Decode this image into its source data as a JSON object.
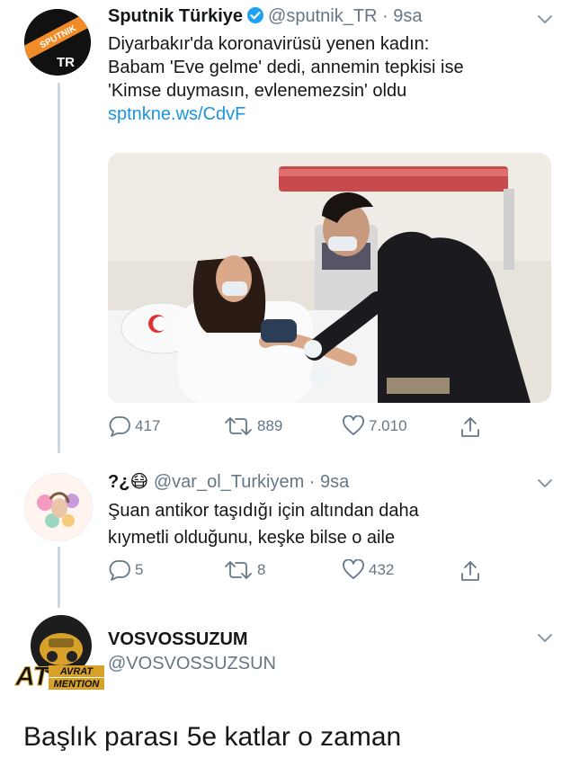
{
  "tweets": [
    {
      "name": "Sputnik Türkiye",
      "handle": "@sputnik_TR",
      "time": "9sa",
      "avatar_text": {
        "brand": "SPUTNIK",
        "country": "TR"
      },
      "text_lines": [
        "Diyarbakır'da koronavirüsü yenen kadın:",
        "Babam 'Eve gelme' dedi, annemin tepkisi ise",
        "'Kimse duymasın, evlenemezsin' oldu"
      ],
      "link": "sptnkne.ws/CdvF",
      "replies": "417",
      "retweets": "889",
      "likes": "7.010"
    },
    {
      "name": "?¿😷",
      "handle": "@var_ol_Turkiyem",
      "time": "9sa",
      "text_lines": [
        "Şuan antikor taşıdığı için altından daha",
        "kıymetli olduğunu, keşke bilse o aile"
      ],
      "replies": "5",
      "retweets": "8",
      "likes": "432"
    },
    {
      "name": "VOSVOSSUZUM",
      "handle": "@VOSVOSSUZSUN",
      "logo_text": {
        "big": "AT",
        "line1": "AVRAT",
        "line2": "MENTION"
      }
    }
  ],
  "caption": "Başlık parası 5e katlar o zaman",
  "colors": {
    "name": "#14171a",
    "handle": "#657786",
    "link": "#1b95e0",
    "verified": "#1da1f2",
    "thread_line": "#ccd6dd"
  },
  "icons": [
    "reply-icon",
    "retweet-icon",
    "like-icon",
    "share-icon",
    "chevron-down-icon",
    "verified-badge-icon"
  ]
}
